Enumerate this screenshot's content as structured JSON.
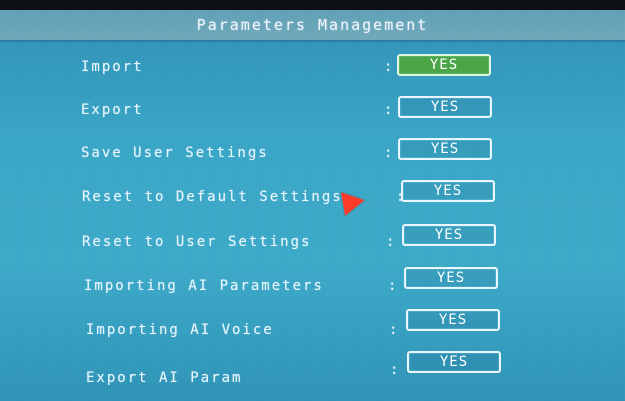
{
  "header": {
    "title": "Parameters Management"
  },
  "rows": [
    {
      "label": "Import",
      "colon": ":",
      "value": "YES",
      "selected": true
    },
    {
      "label": "Export",
      "colon": ":",
      "value": "YES",
      "selected": false
    },
    {
      "label": "Save User Settings",
      "colon": ":",
      "value": "YES",
      "selected": false
    },
    {
      "label": "Reset to Default Settings",
      "colon": ":",
      "value": "YES",
      "selected": false
    },
    {
      "label": "Reset to User Settings",
      "colon": ":",
      "value": "YES",
      "selected": false
    },
    {
      "label": "Importing AI Parameters",
      "colon": ":",
      "value": "YES",
      "selected": false
    },
    {
      "label": "Importing AI Voice",
      "colon": ":",
      "value": "YES",
      "selected": false
    },
    {
      "label": "Export AI Param",
      "colon": ":",
      "value": "YES",
      "selected": false
    }
  ],
  "colors": {
    "background": "#3aa5c6",
    "title_bar": "#6fa7b9",
    "selected_button": "#4aa547",
    "cursor": "#ff3b2a",
    "text": "#e9f6ff"
  },
  "icons": {
    "cursor": "cursor-arrow-icon"
  }
}
